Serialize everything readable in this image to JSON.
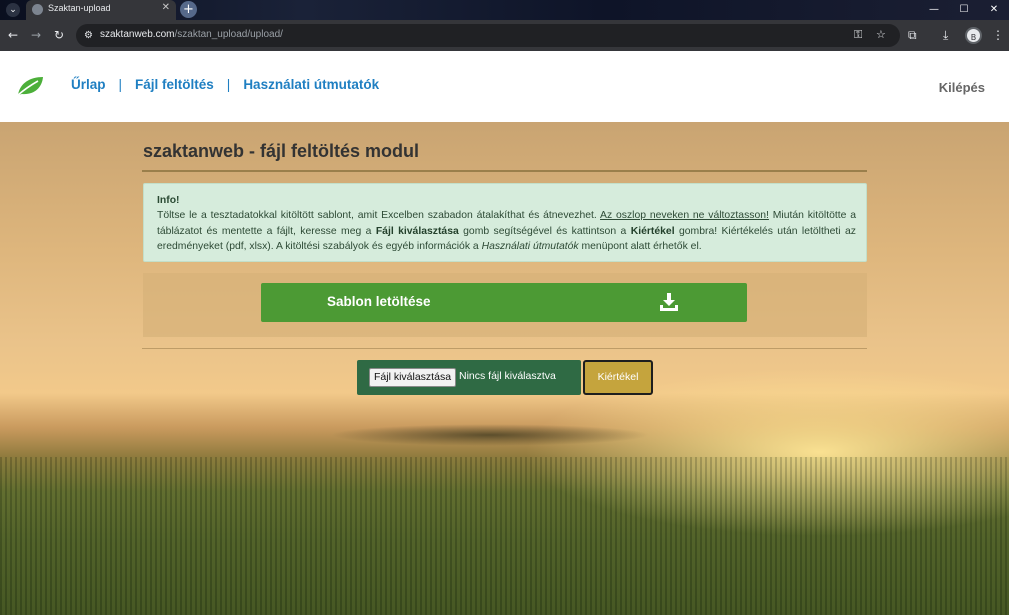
{
  "browser": {
    "tab_title": "Szaktan-upload",
    "url_host": "szaktanweb.com",
    "url_path": "/szaktan_upload/upload/",
    "profile_initial": "B"
  },
  "header": {
    "nav": [
      {
        "label": "Űrlap"
      },
      {
        "label": "Fájl feltöltés"
      },
      {
        "label": "Használati útmutatók"
      }
    ],
    "separator": "|",
    "logout": "Kilépés"
  },
  "main": {
    "title": "szaktanweb - fájl feltöltés modul",
    "info": {
      "heading": "Info!",
      "text_1": "Töltse le a tesztadatokkal kitöltött sablont, amit Excelben szabadon átalakíthat és átnevezhet. ",
      "underline": "Az oszlop neveken ne változtasson!",
      "text_2": " Miután kitöltötte a táblázatot és mentette a fájlt, keresse meg a ",
      "bold_1": "Fájl kiválasztása",
      "text_3": " gomb segítségével és kattintson a ",
      "bold_2": "Kiértékel",
      "text_4": " gombra! Kiértékelés után letöltheti az eredményeket (pdf, xlsx). A kitöltési szabályok és egyéb információk a ",
      "italic": "Használati útmutatók",
      "text_5": " menüpont alatt érhetők el."
    },
    "download_label": "Sablon letöltése",
    "file_button": "Fájl kiválasztása",
    "file_status": "Nincs fájl kiválasztva",
    "evaluate_label": "Kiértékel"
  },
  "colors": {
    "nav_link": "#1f7fc2",
    "download_green": "#4c9a34",
    "file_box_green": "#2f6a44",
    "evaluate_gold": "#c5a43d",
    "info_bg": "#d6ecdc"
  }
}
